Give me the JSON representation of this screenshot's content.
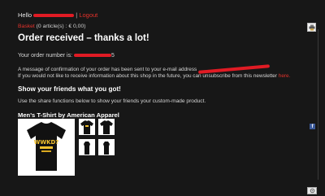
{
  "header": {
    "hello": "Hello",
    "logout": "Logout"
  },
  "basket": {
    "link": "Basket",
    "summary": "(0 article(s) : € 0,00)"
  },
  "confirmation": {
    "title": "Order received – thanks a lot!",
    "order_number_label": "Your order number is:",
    "order_number_tail": "5",
    "message_line1": "A message of confirmation of your order has been sent to your e-mail address",
    "message_line2": "If you would not like to receive information about this shop in the future, you can unsubscribe from this newsletter",
    "message_link": "here."
  },
  "share": {
    "heading": "Show your friends what you got!",
    "text": "Use the share functions below to show your friends your custom-made product."
  },
  "product": {
    "title": "Men's T-Shirt by American Apparel",
    "print_text": "WWKD?"
  },
  "colors": {
    "background": "#171717",
    "accent_red": "#e4322b",
    "redaction": "#e01b24",
    "facebook": "#3b5998"
  },
  "icons": {
    "top_right": "print-icon",
    "share": "facebook-icon",
    "bottom_right": "gear-icon"
  }
}
